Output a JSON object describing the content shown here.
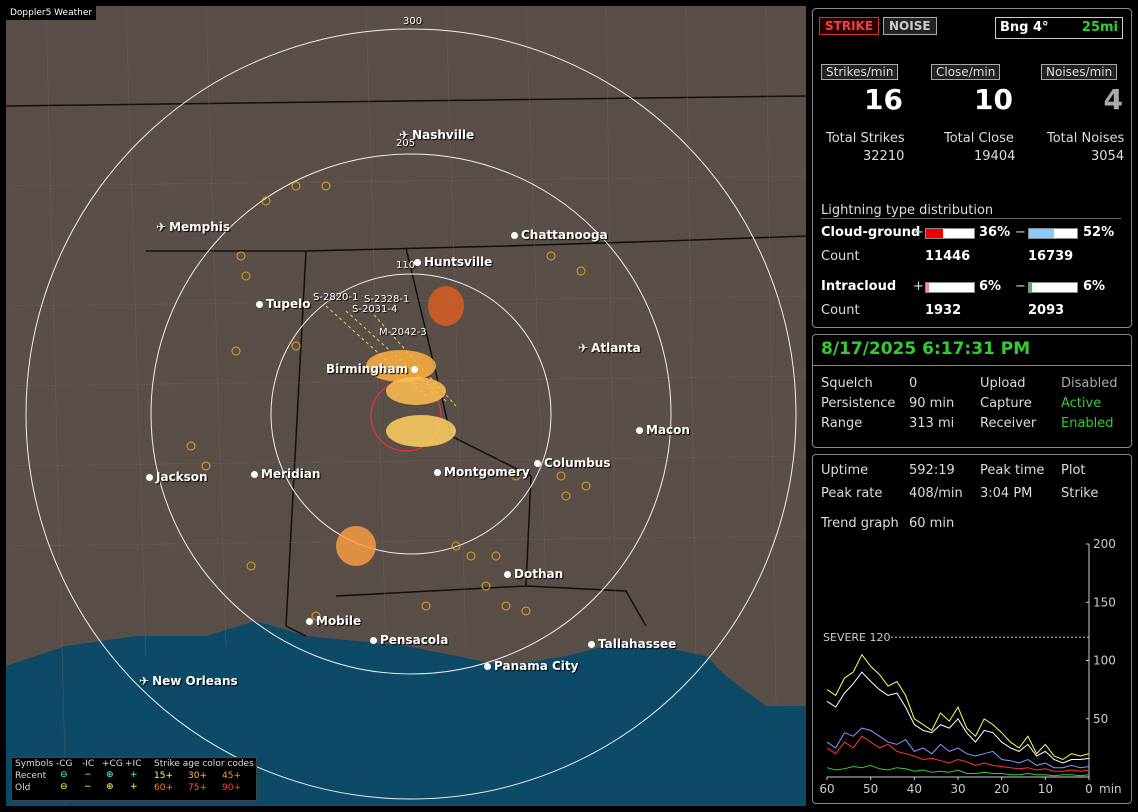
{
  "map": {
    "title": "Doppler5 Weather",
    "rings": [
      "300",
      "205",
      "110"
    ],
    "cities": [
      {
        "name": "Nashville",
        "kind": "airport"
      },
      {
        "name": "Memphis",
        "kind": "airport"
      },
      {
        "name": "Chattanooga",
        "kind": "city"
      },
      {
        "name": "Huntsville",
        "kind": "city"
      },
      {
        "name": "Tupelo",
        "kind": "city"
      },
      {
        "name": "Atlanta",
        "kind": "airport"
      },
      {
        "name": "Birmingham",
        "kind": "city"
      },
      {
        "name": "Macon",
        "kind": "city"
      },
      {
        "name": "Jackson",
        "kind": "city"
      },
      {
        "name": "Meridian",
        "kind": "city"
      },
      {
        "name": "Montgomery",
        "kind": "city"
      },
      {
        "name": "Columbus",
        "kind": "city"
      },
      {
        "name": "Dothan",
        "kind": "city"
      },
      {
        "name": "Mobile",
        "kind": "city"
      },
      {
        "name": "Pensacola",
        "kind": "city"
      },
      {
        "name": "Tallahassee",
        "kind": "city"
      },
      {
        "name": "Panama City",
        "kind": "city"
      },
      {
        "name": "New Orleans",
        "kind": "airport"
      }
    ],
    "cells": [
      "S-2820-1",
      "S-2328-1",
      "S-2031-4",
      "M-2042-3"
    ],
    "legend": {
      "symbols_label": "Symbols",
      "cols": [
        "-CG",
        "-IC",
        "+CG",
        "+IC"
      ],
      "age_label": "Strike age color codes",
      "recent_label": "Recent",
      "old_label": "Old",
      "recent_ages": [
        "15+",
        "30+",
        "45+"
      ],
      "old_ages": [
        "60+",
        "75+",
        "90+"
      ]
    }
  },
  "top": {
    "strike_btn": "STRIKE",
    "noise_btn": "NOISE",
    "bearing": "Bng 4°",
    "range": "25mi",
    "strikes_min_label": "Strikes/min",
    "close_min_label": "Close/min",
    "noises_min_label": "Noises/min",
    "strikes_min": "16",
    "close_min": "10",
    "noises_min": "4",
    "total_strikes_label": "Total Strikes",
    "total_close_label": "Total Close",
    "total_noises_label": "Total Noises",
    "total_strikes": "32210",
    "total_close": "19404",
    "total_noises": "3054",
    "dist_title": "Lightning type distribution",
    "cg_label": "Cloud-ground",
    "ic_label": "Intracloud",
    "count_label": "Count",
    "plus": "+",
    "minus": "−",
    "cg_pos_pct": "36%",
    "cg_neg_pct": "52%",
    "cg_pos_count": "11446",
    "cg_neg_count": "16739",
    "ic_pos_pct": "6%",
    "ic_neg_pct": "6%",
    "ic_pos_count": "1932",
    "ic_neg_count": "2093"
  },
  "bars": {
    "cg_pos": 0.36,
    "cg_neg": 0.52,
    "ic_pos": 0.06,
    "ic_neg": 0.06
  },
  "status": {
    "datetime": "8/17/2025 6:17:31 PM",
    "squelch_label": "Squelch",
    "squelch": "0",
    "persistence_label": "Persistence",
    "persistence": "90 min",
    "range_label": "Range",
    "range": "313 mi",
    "upload_label": "Upload",
    "upload": "Disabled",
    "capture_label": "Capture",
    "capture": "Active",
    "receiver_label": "Receiver",
    "receiver": "Enabled"
  },
  "trend": {
    "uptime_label": "Uptime",
    "uptime": "592:19",
    "peak_time_label": "Peak time",
    "peak_time": "3:04 PM",
    "plot_label": "Plot",
    "plot": "Strike",
    "peak_rate_label": "Peak rate",
    "peak_rate": "408/min",
    "trend_graph_label": "Trend graph",
    "trend_graph": "60 min",
    "severe_label": "SEVERE 120"
  },
  "chart_data": {
    "type": "line",
    "x": [
      60,
      58,
      56,
      54,
      52,
      50,
      48,
      46,
      44,
      42,
      40,
      38,
      36,
      34,
      32,
      30,
      28,
      26,
      24,
      22,
      20,
      18,
      16,
      14,
      12,
      10,
      8,
      6,
      4,
      2,
      0
    ],
    "xticks": [
      "60",
      "50",
      "40",
      "30",
      "20",
      "10",
      "0"
    ],
    "x_unit": "min",
    "yticks": [
      "200",
      "150",
      "100",
      "50"
    ],
    "ylim": [
      0,
      200
    ],
    "threshold": 120,
    "series": [
      {
        "color": "#ffff66",
        "values": [
          75,
          70,
          85,
          90,
          105,
          95,
          88,
          78,
          82,
          70,
          50,
          45,
          40,
          55,
          48,
          60,
          42,
          35,
          50,
          45,
          38,
          30,
          25,
          35,
          20,
          28,
          18,
          15,
          20,
          18,
          20
        ]
      },
      {
        "color": "#ffffff",
        "values": [
          65,
          60,
          72,
          80,
          90,
          82,
          75,
          70,
          72,
          60,
          45,
          40,
          38,
          45,
          42,
          50,
          38,
          30,
          40,
          38,
          30,
          25,
          22,
          28,
          18,
          22,
          15,
          12,
          15,
          15,
          16
        ]
      },
      {
        "color": "#8899ff",
        "values": [
          30,
          25,
          38,
          35,
          42,
          40,
          35,
          30,
          28,
          32,
          22,
          25,
          20,
          28,
          22,
          25,
          20,
          18,
          20,
          22,
          15,
          14,
          12,
          15,
          10,
          12,
          8,
          8,
          10,
          8,
          9
        ]
      },
      {
        "color": "#ff3333",
        "values": [
          25,
          20,
          30,
          25,
          35,
          30,
          25,
          28,
          22,
          20,
          18,
          15,
          16,
          14,
          12,
          15,
          13,
          10,
          12,
          10,
          9,
          8,
          7,
          8,
          6,
          7,
          5,
          5,
          6,
          5,
          6
        ]
      },
      {
        "color": "#33cc33",
        "values": [
          8,
          6,
          7,
          9,
          8,
          10,
          7,
          6,
          8,
          7,
          5,
          6,
          4,
          5,
          4,
          6,
          3,
          3,
          4,
          3,
          3,
          2,
          2,
          3,
          2,
          2,
          1,
          2,
          2,
          1,
          2
        ]
      }
    ]
  }
}
